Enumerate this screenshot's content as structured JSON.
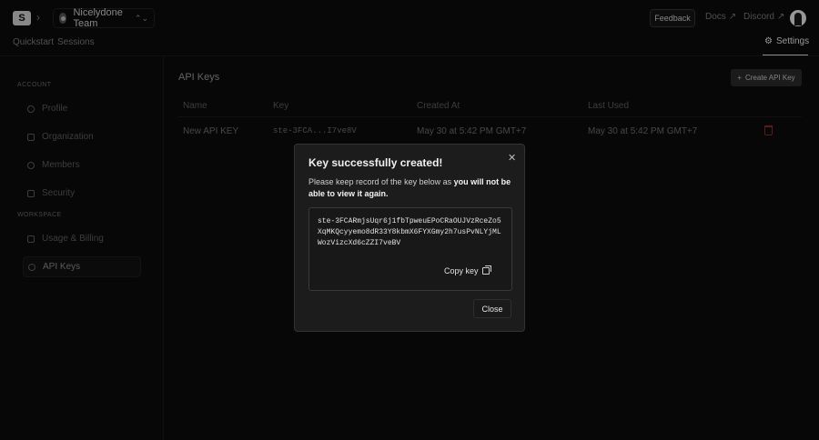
{
  "header": {
    "breadcrumb_sep": "›",
    "team_name": "Nicelydone Team",
    "team_switch_icon": "⌃⌄",
    "feedback_label": "Feedback",
    "docs_label": "Docs",
    "discord_label": "Discord",
    "external_arrow": "↗"
  },
  "nav": {
    "quickstart": "Quickstart",
    "sessions": "Sessions",
    "settings": "Settings",
    "settings_icon": "⚙"
  },
  "sidebar": {
    "account_label": "ACCOUNT",
    "workspace_label": "WORKSPACE",
    "items": [
      {
        "label": "Profile"
      },
      {
        "label": "Organization"
      },
      {
        "label": "Members"
      },
      {
        "label": "Security"
      },
      {
        "label": "Usage & Billing"
      },
      {
        "label": "API Keys"
      }
    ]
  },
  "main": {
    "title": "API Keys",
    "create_label": "Create API Key",
    "create_icon": "+",
    "columns": [
      "Name",
      "Key",
      "Created At",
      "Last Used"
    ],
    "rows": [
      {
        "name": "New API KEY",
        "key": "ste-3FCA...I7ve8V",
        "created": "May 30 at 5:42 PM GMT+7",
        "last_used": "May 30 at 5:42 PM GMT+7"
      }
    ]
  },
  "modal": {
    "title": "Key successfully created!",
    "close_icon": "✕",
    "desc_prefix": "Please keep record of the key below as ",
    "desc_bold": "you will not be able to view it again.",
    "key_value": "ste-3FCARmjsUqr6j1fbTpweuEPoCRaOUJVzRceZo5XqMKQcyyemo8dR33Y8kbmX6FYXGmy2h7usPvNLYjMLWozVizcXd6cZZI7veBV",
    "copy_label": "Copy key",
    "close_label": "Close"
  },
  "colors": {
    "background": "#0b0b0b",
    "modal_bg": "#1c1c1c",
    "danger": "#8a2a2a"
  }
}
